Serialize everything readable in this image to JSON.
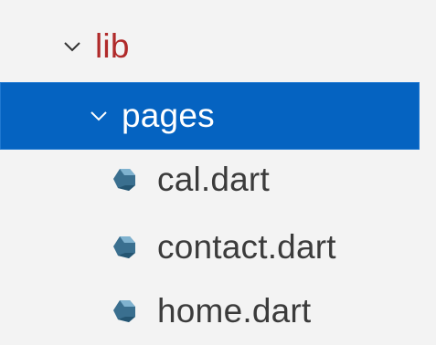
{
  "explorer": {
    "items": [
      {
        "label": "lib",
        "type": "folder",
        "expanded": true,
        "icon": "chevron-down-icon"
      },
      {
        "label": "pages",
        "type": "folder",
        "expanded": true,
        "selected": true,
        "icon": "chevron-down-icon"
      },
      {
        "label": "cal.dart",
        "type": "file",
        "icon": "dart-file-icon"
      },
      {
        "label": "contact.dart",
        "type": "file",
        "icon": "dart-file-icon"
      },
      {
        "label": "home.dart",
        "type": "file",
        "icon": "dart-file-icon"
      }
    ]
  },
  "colors": {
    "background": "#f3f3f3",
    "selection": "#0563c1",
    "lib_folder_text": "#b02a2a",
    "file_text": "#3b3b3b",
    "dart_icon": "#3a6f8f"
  }
}
